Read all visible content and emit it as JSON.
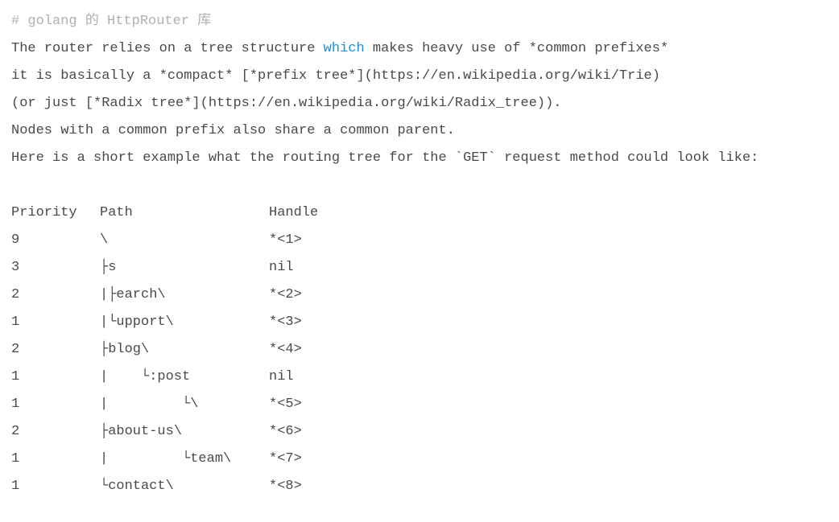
{
  "comment": "# golang 的 HttpRouter 库",
  "para1": {
    "pre": "The router relies on a tree structure ",
    "hl": "which",
    "post": " makes heavy use of *common prefixes*"
  },
  "para2": "it is basically a *compact* [*prefix tree*](https://en.wikipedia.org/wiki/Trie)",
  "para3": "(or just [*Radix tree*](https://en.wikipedia.org/wiki/Radix_tree)).",
  "para4": "Nodes with a common prefix also share a common parent.",
  "para5": "Here is a short example what the routing tree for the `GET` request method could look like:",
  "headers": {
    "priority": "Priority",
    "path": "Path",
    "handle": "Handle"
  },
  "rows": [
    {
      "priority": "9",
      "path": "\\",
      "handle": "*<1>"
    },
    {
      "priority": "3",
      "path": "├s",
      "handle": "nil"
    },
    {
      "priority": "2",
      "path": "|├earch\\",
      "handle": "*<2>"
    },
    {
      "priority": "1",
      "path": "|└upport\\",
      "handle": "*<3>"
    },
    {
      "priority": "2",
      "path": "├blog\\",
      "handle": "*<4>"
    },
    {
      "priority": "1",
      "path": "|    └:post",
      "handle": "nil"
    },
    {
      "priority": "1",
      "path": "|         └\\",
      "handle": "*<5>"
    },
    {
      "priority": "2",
      "path": "├about-us\\",
      "handle": "*<6>"
    },
    {
      "priority": "1",
      "path": "|         └team\\",
      "handle": "*<7>"
    },
    {
      "priority": "1",
      "path": "└contact\\",
      "handle": "*<8>"
    }
  ]
}
